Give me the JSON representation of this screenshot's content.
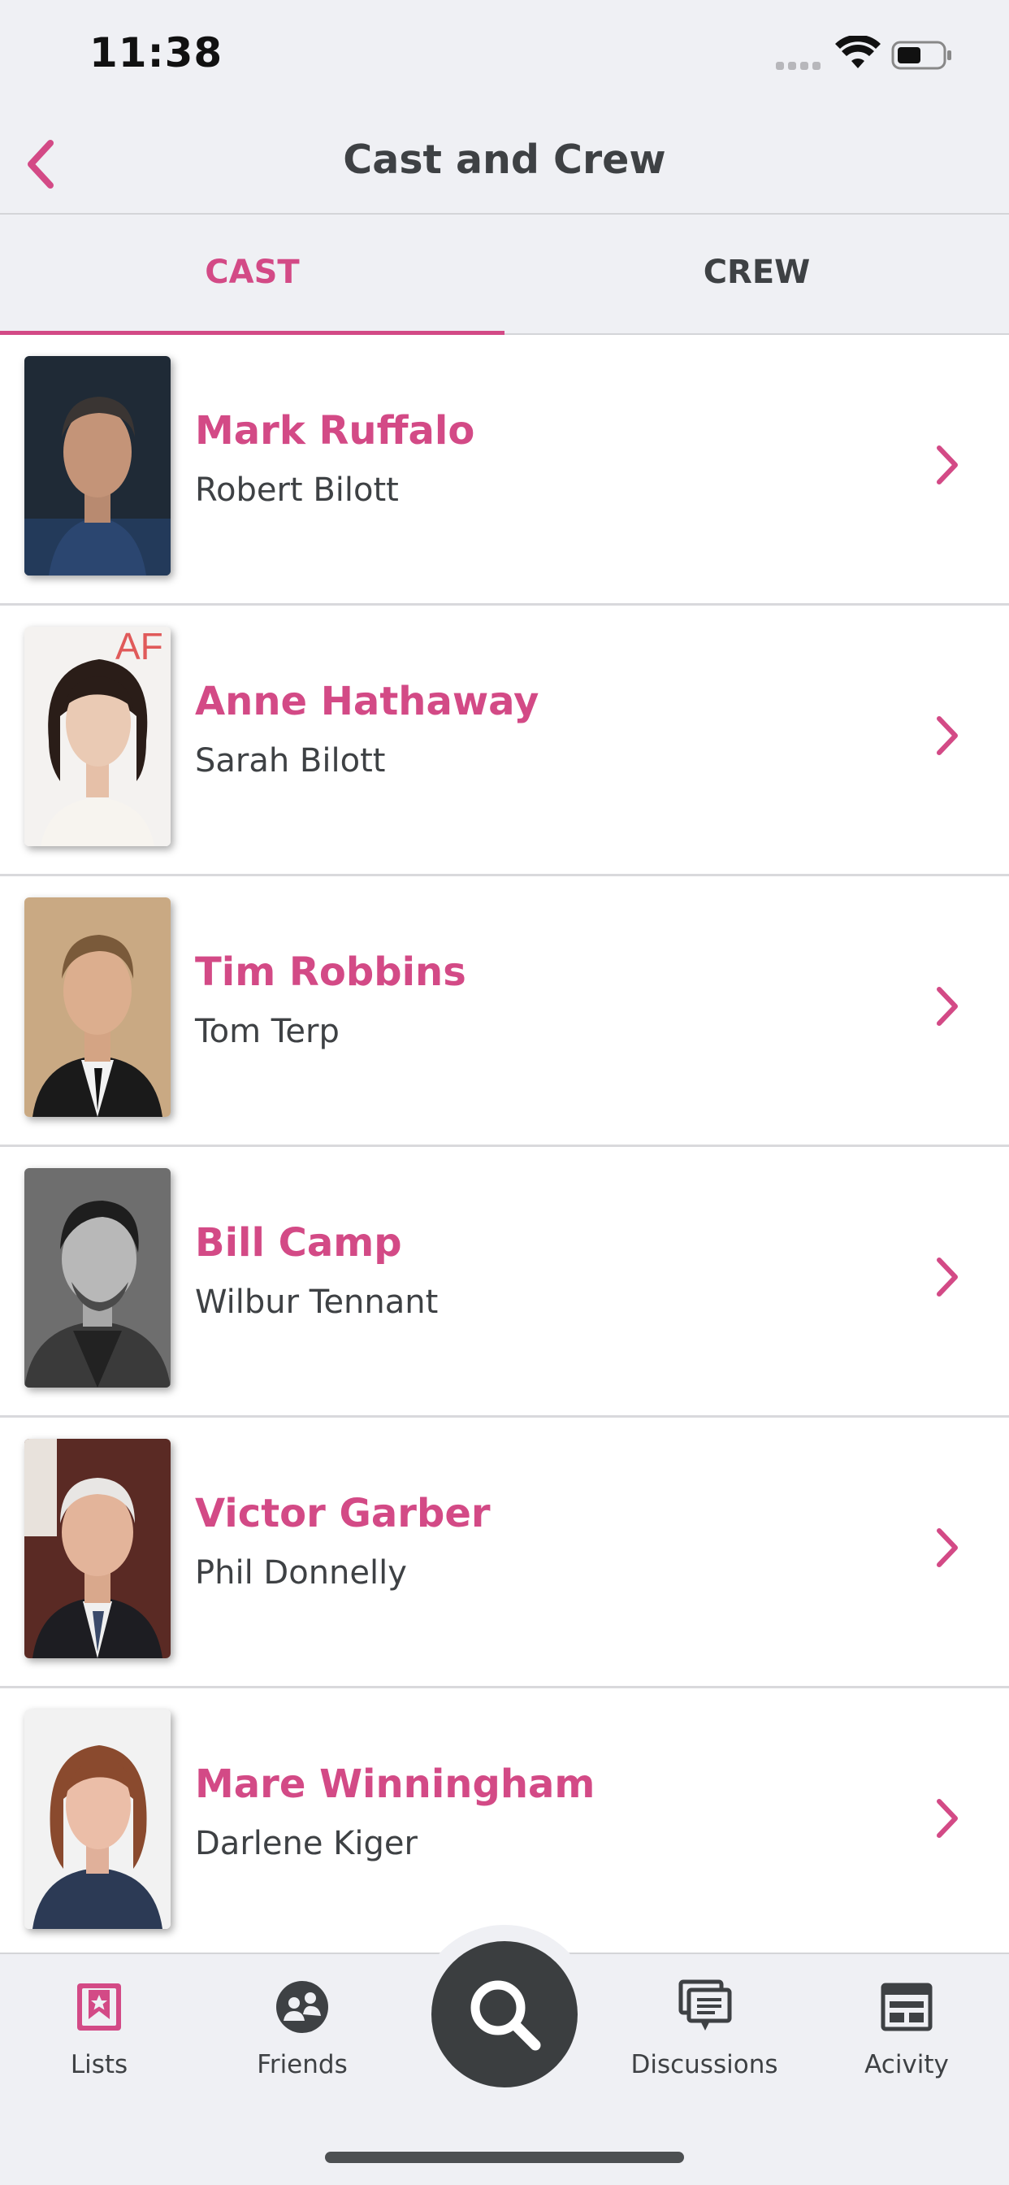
{
  "status_bar": {
    "time": "11:38"
  },
  "nav": {
    "title": "Cast and Crew"
  },
  "tabs": [
    {
      "label": "CAST",
      "selected": true
    },
    {
      "label": "CREW",
      "selected": false
    }
  ],
  "cast": [
    {
      "actor": "Mark Ruffalo",
      "role": "Robert Bilott"
    },
    {
      "actor": "Anne Hathaway",
      "role": "Sarah Bilott"
    },
    {
      "actor": "Tim Robbins",
      "role": "Tom Terp"
    },
    {
      "actor": "Bill Camp",
      "role": "Wilbur Tennant"
    },
    {
      "actor": "Victor Garber",
      "role": "Phil Donnelly"
    },
    {
      "actor": "Mare Winningham",
      "role": "Darlene Kiger"
    }
  ],
  "tab_bar": {
    "items": [
      {
        "label": "Lists",
        "icon": "lists-icon",
        "active": true
      },
      {
        "label": "Friends",
        "icon": "friends-icon"
      },
      {
        "label": "Discussions",
        "icon": "discussions-icon"
      },
      {
        "label": "Acivity",
        "icon": "activity-icon"
      }
    ],
    "center_icon": "search-icon"
  },
  "colors": {
    "accent": "#d34a86",
    "text": "#3e4144",
    "bar_bg": "#eff0f4",
    "fab": "#3b3e40"
  }
}
